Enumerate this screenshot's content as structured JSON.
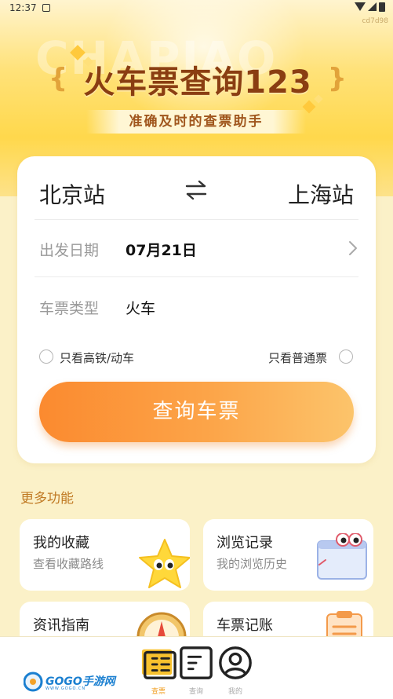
{
  "status_bar": {
    "time": "12:37"
  },
  "header": {
    "bg_letters": "CHAPIAO",
    "watermark_id": "cd7d98",
    "app_title": "火车票查询123",
    "bracket_left": "{",
    "bracket_right": "}",
    "subtitle": "准确及时的查票助手"
  },
  "search": {
    "from_station": "北京站",
    "to_station": "上海站",
    "swap_icon": "swap-arrows-icon",
    "date_label": "出发日期",
    "date_value": "07月21日",
    "type_label": "车票类型",
    "type_value": "火车",
    "option_high_speed": "只看高铁/动车",
    "option_normal": "只看普通票",
    "query_button": "查询车票"
  },
  "more": {
    "section_title": "更多功能",
    "features": [
      {
        "title": "我的收藏",
        "subtitle": "查看收藏路线",
        "icon": "star-mascot-icon"
      },
      {
        "title": "浏览记录",
        "subtitle": "我的浏览历史",
        "icon": "browser-window-icon"
      },
      {
        "title": "资讯指南",
        "subtitle": "",
        "icon": "compass-icon"
      },
      {
        "title": "车票记账",
        "subtitle": "",
        "icon": "clipboard-icon"
      }
    ]
  },
  "bottom_nav": {
    "items": [
      {
        "label": "查票",
        "icon": "ticket-icon",
        "active": true
      },
      {
        "label": "查询",
        "icon": "document-icon",
        "active": false
      },
      {
        "label": "我的",
        "icon": "user-icon",
        "active": false
      }
    ],
    "logo_text": "GOGO手游网",
    "logo_sub": "WWW.GOGO.CN"
  },
  "colors": {
    "accent_orange": "#fb8a2f",
    "title_brown": "#8a3e12",
    "section_title": "#c07a24",
    "nav_active": "#f2a22a"
  }
}
